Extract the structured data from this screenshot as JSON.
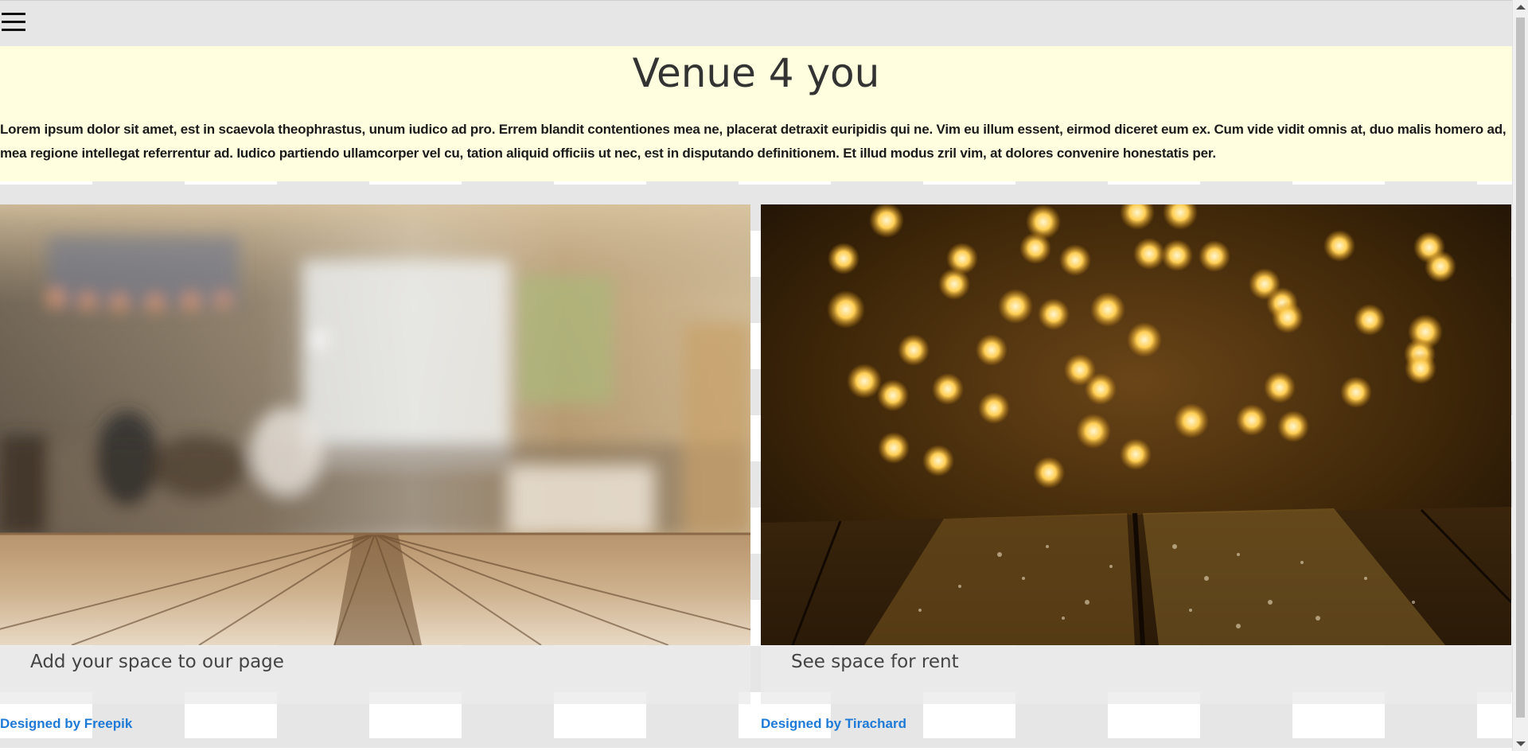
{
  "header": {
    "menu_icon": "hamburger-menu-icon",
    "title": "Venue 4 you",
    "intro": "Lorem ipsum dolor sit amet, est in scaevola theophrastus, unum iudico ad pro. Errem blandit contentiones mea ne, placerat detraxit euripidis qui ne. Vim eu illum essent, eirmod diceret eum ex. Cum vide vidit omnis at, duo malis homero ad, mea regione intellegat referrentur ad. Iudico partiendo ullamcorper vel cu, tation aliquid officiis ut nec, est in disputando definitionem. Et illud modus zril vim, at dolores convenire honestatis per."
  },
  "cards": [
    {
      "caption": "Add your space to our page",
      "credit": "Designed by Freepik"
    },
    {
      "caption": "See space for rent",
      "credit": "Designed by Tirachard"
    }
  ],
  "colors": {
    "header_band": "#ffffdf",
    "link": "#1e7ad6",
    "title": "#333333",
    "checker": "#e6e6e6"
  }
}
